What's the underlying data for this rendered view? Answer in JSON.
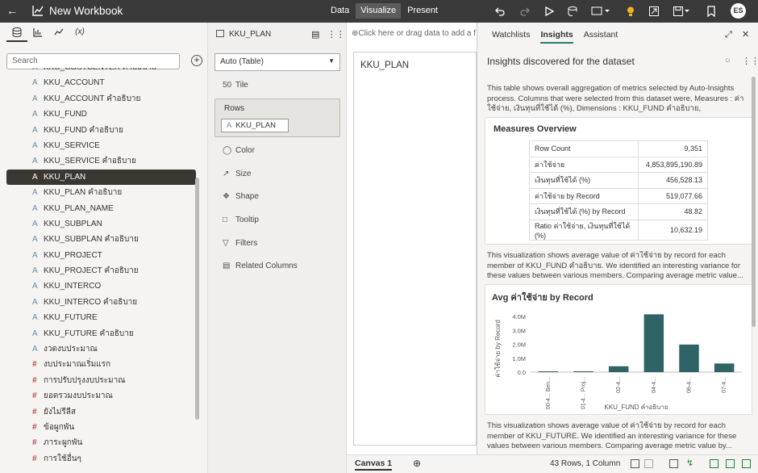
{
  "topbar": {
    "title": "New Workbook",
    "tabs": [
      "Data",
      "Visualize",
      "Present"
    ],
    "active_tab": "Visualize",
    "avatar": "ES",
    "bg": "#3a3a3a"
  },
  "left": {
    "tabs": [
      "data-icon",
      "chart-icon",
      "trend-icon",
      "(x)"
    ],
    "search_placeholder": "Search",
    "items": [
      {
        "label": "KKU_COSTCENTER คำอธิบาย",
        "type": "A"
      },
      {
        "label": "KKU_ACCOUNT",
        "type": "A"
      },
      {
        "label": "KKU_ACCOUNT คำอธิบาย",
        "type": "A"
      },
      {
        "label": "KKU_FUND",
        "type": "A"
      },
      {
        "label": "KKU_FUND คำอธิบาย",
        "type": "A"
      },
      {
        "label": "KKU_SERVICE",
        "type": "A"
      },
      {
        "label": "KKU_SERVICE คำอธิบาย",
        "type": "A"
      },
      {
        "label": "KKU_PLAN",
        "type": "A",
        "selected": true
      },
      {
        "label": "KKU_PLAN คำอธิบาย",
        "type": "A"
      },
      {
        "label": "KKU_PLAN_NAME",
        "type": "A"
      },
      {
        "label": "KKU_SUBPLAN",
        "type": "A"
      },
      {
        "label": "KKU_SUBPLAN คำอธิบาย",
        "type": "A"
      },
      {
        "label": "KKU_PROJECT",
        "type": "A"
      },
      {
        "label": "KKU_PROJECT คำอธิบาย",
        "type": "A"
      },
      {
        "label": "KKU_INTERCO",
        "type": "A"
      },
      {
        "label": "KKU_INTERCO คำอธิบาย",
        "type": "A"
      },
      {
        "label": "KKU_FUTURE",
        "type": "A"
      },
      {
        "label": "KKU_FUTURE คำอธิบาย",
        "type": "A"
      },
      {
        "label": "งวดงบประมาณ",
        "type": "A"
      },
      {
        "label": "งบประมาณเริ่มแรก",
        "type": "#"
      },
      {
        "label": "การปรับปรุงงบประมาณ",
        "type": "#"
      },
      {
        "label": "ยอดรวมงบประมาณ",
        "type": "#"
      },
      {
        "label": "ยังไม่รีลีส",
        "type": "#"
      },
      {
        "label": "ข้อผูกพัน",
        "type": "#"
      },
      {
        "label": "ภาระผูกพัน",
        "type": "#"
      },
      {
        "label": "การใช้อื่นๆ",
        "type": "#"
      }
    ]
  },
  "grammar": {
    "header": "KKU_PLAN",
    "viz_type": "Auto (Table)",
    "props": [
      "Tile",
      "Rows",
      "Color",
      "Size",
      "Shape",
      "Tooltip",
      "Filters",
      "Related Columns"
    ],
    "rows_chip": "KKU_PLAN"
  },
  "canvas": {
    "filter_placeholder": "Click here or drag data to add a filt",
    "viz_title": "KKU_PLAN",
    "tab": "Canvas 1",
    "rowcount": "43 Rows, 1 Column"
  },
  "insights": {
    "tabs": [
      "Watchlists",
      "Insights",
      "Assistant"
    ],
    "active": "Insights",
    "heading": "Insights discovered for the dataset",
    "para1": "This table shows overall aggregation of metrics selected by Auto-Insights process. Columns that were selected from this dataset were, Measures : ค่าใช้จ่าย, เงินทุนที่ใช้ได้ (%), Dimensions : KKU_FUND คำอธิบาย, KKU_FUTURE คำ...",
    "measures_title": "Measures Overview",
    "measures": [
      {
        "k": "Row Count",
        "v": "9,351"
      },
      {
        "k": "ค่าใช้จ่าย",
        "v": "4,853,895,190.89"
      },
      {
        "k": "เงินทุนที่ใช้ได้ (%)",
        "v": "456,528.13"
      },
      {
        "k": "ค่าใช้จ่าย by Record",
        "v": "519,077.66"
      },
      {
        "k": "เงินทุนที่ใช้ได้ (%) by Record",
        "v": "48.82"
      },
      {
        "k": "Ratio ค่าใช้จ่าย, เงินทุนที่ใช้ได้ (%)",
        "v": "10,632.19"
      }
    ],
    "para2": "This visualization shows average value of ค่าใช้จ่าย by record for each member of KKU_FUND คำอธิบาย. We identified an interesting variance for these values between various members. Comparing average metric value...",
    "para3": "This visualization shows average value of ค่าใช้จ่าย by record for each member of KKU_FUTURE. We identified an interesting variance for these values between various members. Comparing average metric value by..."
  },
  "chart_data": {
    "type": "bar",
    "title": "Avg ค่าใช้จ่าย by Record",
    "xlabel": "KKU_FUND คำอธิบาย",
    "ylabel": "ค่าใช้จ่าย by Record",
    "yticks": [
      "0.0",
      "1.0M",
      "2.0M",
      "3.0M",
      "4.0M"
    ],
    "ylim": [
      0,
      4400000
    ],
    "categories": [
      "00-4... Ben...",
      "01-4... Proj...",
      "02-4...",
      "04-4...",
      "06-4...",
      "07-4..."
    ],
    "values": [
      20000,
      60000,
      420000,
      4150000,
      1980000,
      620000
    ],
    "color": "#2e6466"
  }
}
